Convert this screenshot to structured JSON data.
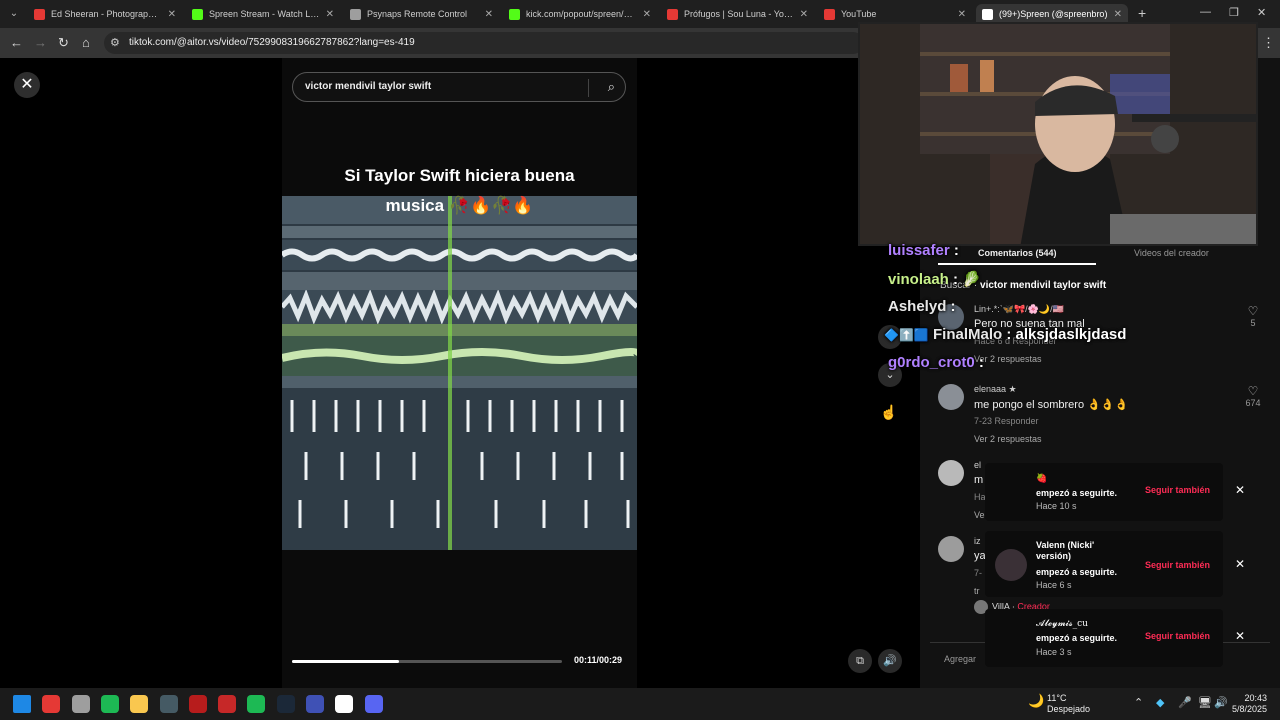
{
  "browser": {
    "tabs": [
      {
        "title": "Ed Sheeran - Photograph (Offic",
        "favicon_color": "#e53935"
      },
      {
        "title": "Spreen Stream - Watch Live on",
        "favicon_color": "#53fc18"
      },
      {
        "title": "Psynaps Remote Control",
        "favicon_color": "#9e9e9e"
      },
      {
        "title": "kick.com/popout/spreen/chat",
        "favicon_color": "#53fc18"
      },
      {
        "title": "Prófugos | Sou Luna - YouTube",
        "favicon_color": "#e53935"
      },
      {
        "title": "YouTube",
        "favicon_color": "#e53935"
      },
      {
        "title": "(99+)Spreen (@spreenbro)",
        "favicon_color": "#ffffff"
      }
    ],
    "url": "tiktok.com/@aitor.vs/video/7529908319662787862?lang=es-419"
  },
  "video": {
    "search_value": "victor mendivil taylor swift",
    "caption_line1": "Si Taylor Swift hiciera buena",
    "caption_line2": "musica 🥀🔥🥀🔥",
    "progress": 0.395,
    "timecode": "00:11/00:29"
  },
  "chat": [
    {
      "user": "luissafer",
      "message": "",
      "color": "#b080ff"
    },
    {
      "user": "vinolaah",
      "message": "🥬",
      "color": "#c7f08a"
    },
    {
      "user": "Ashelyd",
      "message": "",
      "color": "#e8e8e8"
    },
    {
      "user": "FinalMalo",
      "message": "alksjdaslkjdasd",
      "color": "#e8e8e8"
    },
    {
      "user": "g0rdo_crot0",
      "message": "",
      "color": "#b080ff"
    }
  ],
  "comments_panel": {
    "tab_comments": "Comentarios (544)",
    "tab_videos": "Videos del creador",
    "related_prefix": "Buscar · ",
    "related_query": "victor mendivil taylor swift",
    "comments": [
      {
        "user": "Lin+.*:ˋ🦋🎀/🌸🌙/🇺🇸",
        "text": "Pero no suena tan mal",
        "meta": "Hace 6 d   Responder",
        "more": "Ver 2 respuestas",
        "likes": "5"
      },
      {
        "user": "elenaaa ★",
        "text": "me pongo el sombrero 👌👌👌",
        "meta": "7-23   Responder",
        "more": "Ver 2 respuestas",
        "likes": "674"
      },
      {
        "user": "el",
        "text": "m",
        "meta": "Ha",
        "more": "Ve",
        "likes": ""
      },
      {
        "user": "iz",
        "text": "ya",
        "meta": "7-",
        "more": "tr",
        "likes": ""
      }
    ],
    "reply_user": "VillA",
    "reply_badge": "Creador",
    "add_comment": "Agregar"
  },
  "notifications": [
    {
      "name": "🍓",
      "action": "empezó a seguirte.",
      "time": "Hace 10 s",
      "follow": "Seguir también"
    },
    {
      "name": "Valenn (Nicki' versión)",
      "action": "empezó a seguirte.",
      "time": "Hace 6 s",
      "follow": "Seguir también"
    },
    {
      "name": "𝓐𝓵𝓮𝔂𝓶𝓲𝓼_cu",
      "action": "empezó a seguirte.",
      "time": "Hace 3 s",
      "follow": "Seguir también"
    }
  ],
  "taskbar": {
    "weather_temp": "11°C",
    "weather_desc": "Despejado",
    "time": "20:43",
    "date": "5/8/2025",
    "icon_colors": [
      "#1e88e5",
      "#e53935",
      "#9e9e9e",
      "#1db954",
      "#f9c74f",
      "#455a64",
      "#b71c1c",
      "#c62828",
      "#1db954",
      "#1b2838",
      "#3f51b5",
      "#ffffff",
      "#5865f2"
    ]
  }
}
